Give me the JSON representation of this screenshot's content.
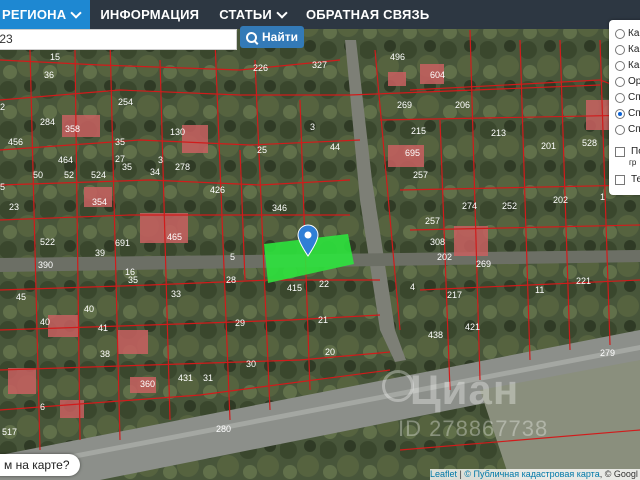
{
  "nav": {
    "region_label": "РЕГИОНА",
    "items": [
      "ИНФОРМАЦИЯ",
      "СТАТЬИ",
      "ОБРАТНАЯ СВЯЗЬ"
    ]
  },
  "search": {
    "value": ":23",
    "button_label": "Найти"
  },
  "layers": {
    "radio_labels": [
      "Ка",
      "Ка",
      "Ка",
      "Ор",
      "Сп",
      "Сп",
      "Сп"
    ],
    "selected_index": 5,
    "check_labels": [
      "По",
      "гр",
      "Те"
    ]
  },
  "map": {
    "parcel_labels": [
      "36",
      "226",
      "327",
      "254",
      "284",
      "358",
      "130",
      "456",
      "35",
      "464",
      "27",
      "3",
      "50",
      "52",
      "25",
      "524",
      "34",
      "354",
      "426",
      "522",
      "23",
      "346",
      "39",
      "390",
      "691",
      "465",
      "28",
      "33",
      "35",
      "40",
      "40",
      "41",
      "38",
      "415",
      "22",
      "21",
      "20",
      "29",
      "30",
      "31",
      "431",
      "360",
      "517",
      "280",
      "35",
      "5",
      "269",
      "206",
      "215",
      "213",
      "201",
      "528",
      "695",
      "257",
      "252",
      "202",
      "257",
      "274",
      "308",
      "269",
      "217",
      "421",
      "202",
      "11",
      "221",
      "279",
      "438",
      "4",
      "6",
      "16",
      "15",
      "496",
      "3",
      "278",
      "45",
      "44",
      "604",
      "2",
      "5",
      "1"
    ],
    "marker_label": "",
    "highlight_color": "#2ee33d",
    "boundary_color": "#d11b1b"
  },
  "help_button": "м на карте?",
  "attribution": {
    "leaflet": "Leaflet",
    "sep": " | ",
    "pkk": "© Публичная кадастровая карта",
    "google": ", © Googl"
  },
  "watermark": {
    "brand": "Циан",
    "id": "ID 278867738"
  }
}
